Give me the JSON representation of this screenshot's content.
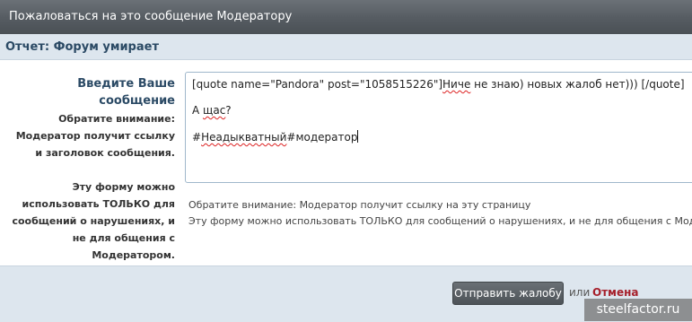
{
  "window": {
    "title": "Пожаловаться на это сообщение Модератору"
  },
  "report": {
    "heading": "Отчет: Форум умирает"
  },
  "form": {
    "message_label": "Введите Ваше сообщение",
    "notice_lines": [
      "Обратите внимание:",
      "Модератор получит ссылку",
      "и заголовок сообщения."
    ],
    "usage_lines": [
      "Эту форму можно",
      "использовать ТОЛЬКО для",
      "сообщений о нарушениях, и",
      "не для общения с",
      "Модератором."
    ],
    "textarea": {
      "line1_prefix": "[quote name=\"Pandora\" post=\"1058515226\"]",
      "line1_spell": "Ниче",
      "line1_suffix": " не знаю) новых жалоб нет))) [/quote]",
      "line2_prefix": "А ",
      "line2_spell": "щас",
      "line2_suffix": "?",
      "line3_prefix": "#",
      "line3_spell": "Неадыкватный",
      "line3_suffix": "#модератор"
    },
    "hint_notice": "Обратите внимание: Модератор получит ссылку на эту страницу",
    "hint_usage": "Эту форму можно использовать ТОЛЬКО для сообщений о нарушениях, и не для общения с Моде"
  },
  "footer": {
    "submit_label": "Отправить жалобу",
    "or_label": "или",
    "cancel_label": "Отмена"
  },
  "watermark": {
    "text": "steelfactor.ru"
  }
}
